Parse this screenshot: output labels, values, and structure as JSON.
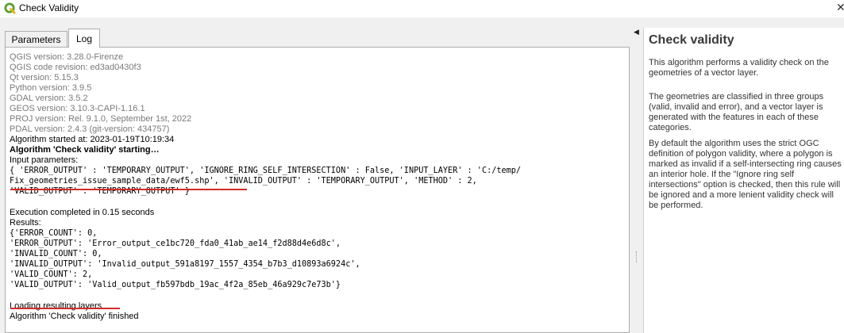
{
  "window": {
    "title": "Check Validity",
    "close_symbol": "✕",
    "logo_icon": "qgis-logo-icon"
  },
  "tabs": [
    {
      "label": "Parameters"
    },
    {
      "label": "Log"
    }
  ],
  "log": {
    "version_lines": [
      "QGIS version: 3.28.0-Firenze",
      "QGIS code revision: ed3ad0430f3",
      "Qt version: 5.15.3",
      "Python version: 3.9.5",
      "GDAL version: 3.5.2",
      "GEOS version: 3.10.3-CAPI-1.16.1",
      "PROJ version: Rel. 9.1.0, September 1st, 2022",
      "PDAL version: 2.4.3 (git-version: 434757)"
    ],
    "started_at": "Algorithm started at: 2023-01-19T10:19:34",
    "starting": "Algorithm 'Check validity' starting…",
    "input_params_label": "Input parameters:",
    "input_params_lines": [
      "{ 'ERROR_OUTPUT' : 'TEMPORARY_OUTPUT', 'IGNORE_RING_SELF_INTERSECTION' : False, 'INPUT_LAYER' : 'C:/temp/",
      "Fix_geometries_issue_sample_data/ewf5.shp', 'INVALID_OUTPUT' : 'TEMPORARY_OUTPUT', 'METHOD' : 2,",
      "'VALID_OUTPUT' : 'TEMPORARY_OUTPUT' }"
    ],
    "execution": "Execution completed in 0.15 seconds",
    "results_label": "Results:",
    "results_lines": [
      "{'ERROR_COUNT': 0,",
      "'ERROR_OUTPUT': 'Error_output_ce1bc720_fda0_41ab_ae14_f2d88d4e6d8c',",
      "'INVALID_COUNT': 0,",
      "'INVALID_OUTPUT': 'Invalid_output_591a8197_1557_4354_b7b3_d10893a6924c',",
      "'VALID_COUNT': 2,",
      "'VALID_OUTPUT': 'Valid_output_fb597bdb_19ac_4f2a_85eb_46a929c7e73b'}"
    ],
    "loading": "Loading resulting layers",
    "finished": "Algorithm 'Check validity' finished"
  },
  "help": {
    "title": "Check validity",
    "paragraphs": [
      "This algorithm performs a validity check on the geometries of a vector layer.",
      "The geometries are classified in three groups (valid, invalid and error), and a vector layer is generated with the features in each of these categories.",
      "By default the algorithm uses the strict OGC definition of polygon validity, where a polygon is marked as invalid if a self-intersecting ring causes an interior hole. If the \"Ignore ring self intersections\" option is checked, then this rule will be ignored and a more lenient validity check will be performed."
    ]
  },
  "splitter": {
    "arrow_symbol": "◀",
    "arrow_icon": "collapse-left-icon"
  },
  "colors": {
    "annotation_underline": "#d42a2a",
    "log_gray": "#7a7a7a"
  }
}
